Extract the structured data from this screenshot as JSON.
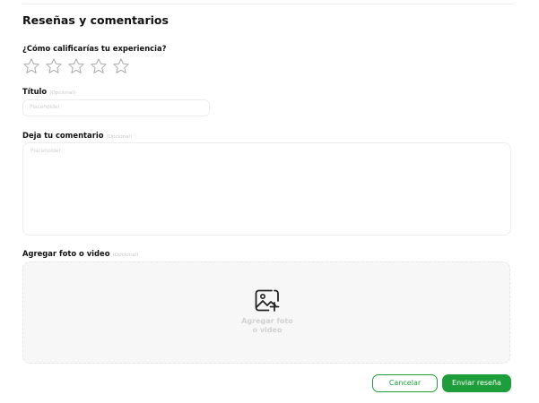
{
  "section_title": "Reseñas y comentarios",
  "rating": {
    "label": "¿Cómo calificarías tu experiencia?",
    "stars_total": 5,
    "stars_selected": 0
  },
  "title_field": {
    "label": "Título",
    "optional": "(Opcional)",
    "placeholder": "Placeholder"
  },
  "comment_field": {
    "label": "Deja tu comentario",
    "optional": "(Opcional)",
    "placeholder": "Placeholder"
  },
  "media_field": {
    "label": "Agregar foto o video",
    "optional": "(Opcional)",
    "dropzone_line1": "Agregar foto",
    "dropzone_line2": "o video",
    "icon": "add-image-icon"
  },
  "actions": {
    "cancel_label": "Cancelar",
    "submit_label": "Enviar reseña"
  },
  "colors": {
    "accent": "#1e9e3a",
    "star_outline": "#9a9a9a",
    "placeholder": "#cfcfcf"
  }
}
